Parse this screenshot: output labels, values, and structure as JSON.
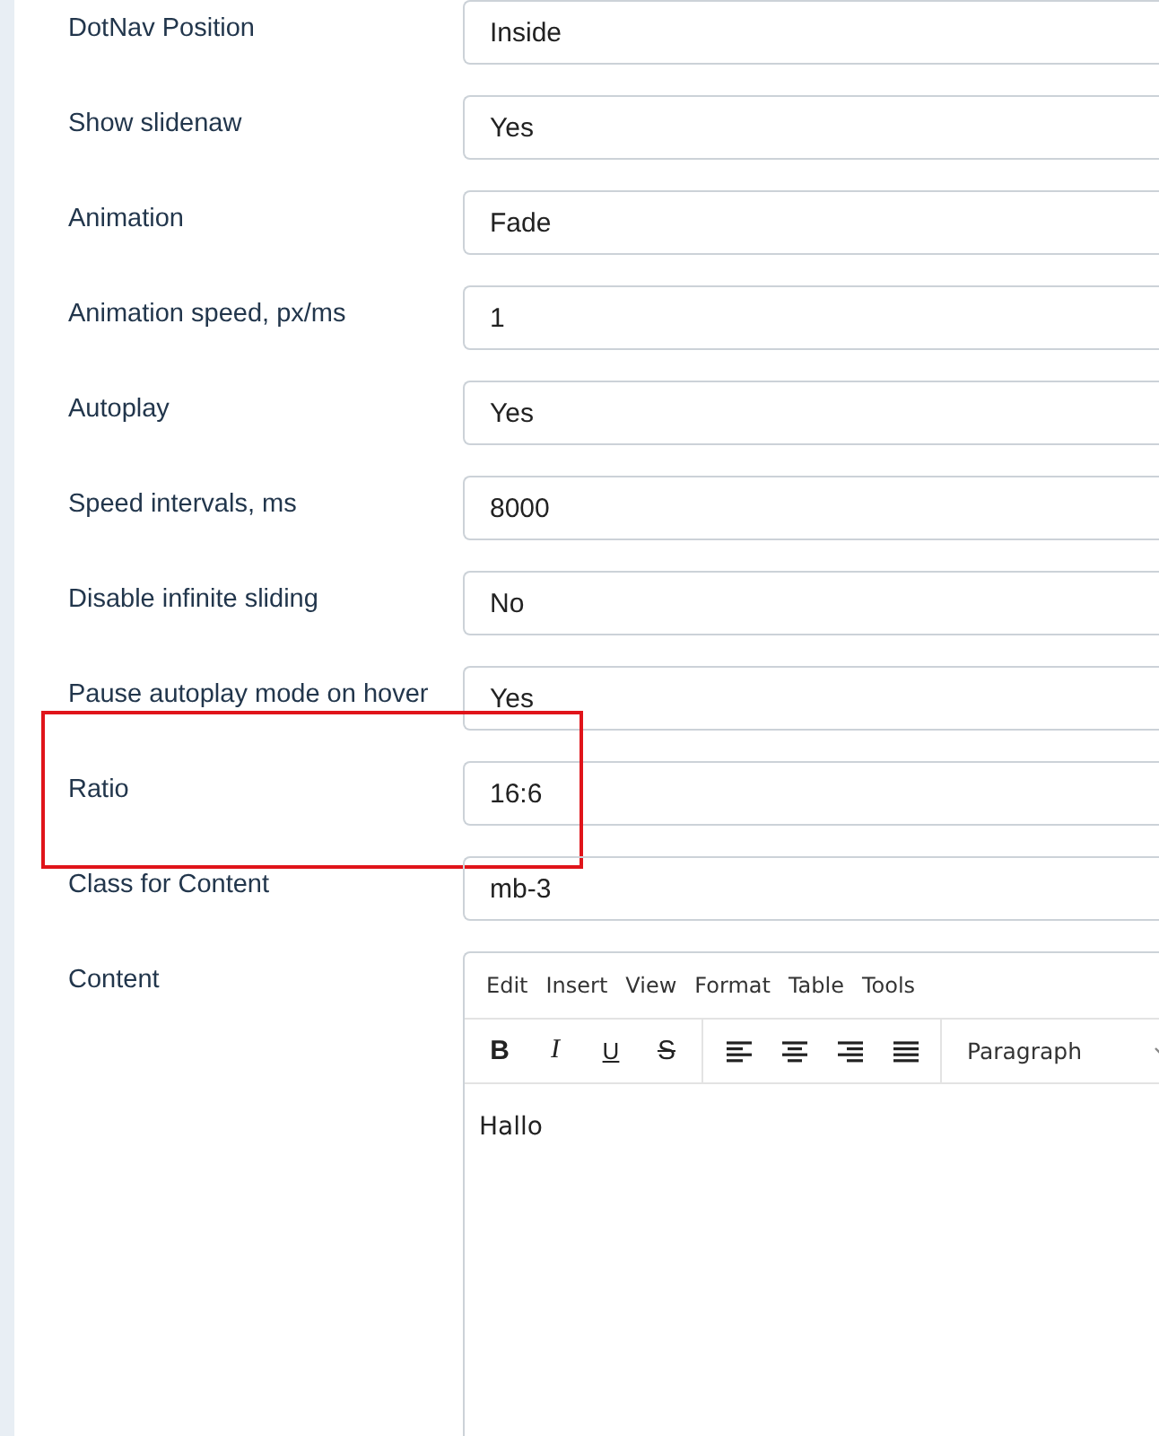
{
  "fields": [
    {
      "label": "DotNav Position",
      "value": "Inside",
      "highlighted": false
    },
    {
      "label": "Show slidenaw",
      "value": "Yes",
      "highlighted": false
    },
    {
      "label": "Animation",
      "value": "Fade",
      "highlighted": false
    },
    {
      "label": "Animation speed, px/ms",
      "value": "1",
      "highlighted": false
    },
    {
      "label": "Autoplay",
      "value": "Yes",
      "highlighted": false
    },
    {
      "label": "Speed intervals, ms",
      "value": "8000",
      "highlighted": false
    },
    {
      "label": "Disable infinite sliding",
      "value": "No",
      "highlighted": false
    },
    {
      "label": "Pause autoplay mode on hover",
      "value": "Yes",
      "highlighted": false
    },
    {
      "label": "Ratio",
      "value": "16:6",
      "highlighted": true
    },
    {
      "label": "Class for Content",
      "value": "mb-3",
      "highlighted": false
    }
  ],
  "content": {
    "label": "Content",
    "menu": [
      "Edit",
      "Insert",
      "View",
      "Format",
      "Table",
      "Tools"
    ],
    "format_buttons": [
      {
        "kind": "bold",
        "glyph": "B"
      },
      {
        "kind": "italic",
        "glyph": "I"
      },
      {
        "kind": "underline",
        "glyph": "U"
      },
      {
        "kind": "strike",
        "glyph": "S"
      }
    ],
    "align_buttons": [
      {
        "kind": "left"
      },
      {
        "kind": "center"
      },
      {
        "kind": "right"
      },
      {
        "kind": "justify"
      }
    ],
    "block_format": "Paragraph",
    "text": "Hallo"
  }
}
